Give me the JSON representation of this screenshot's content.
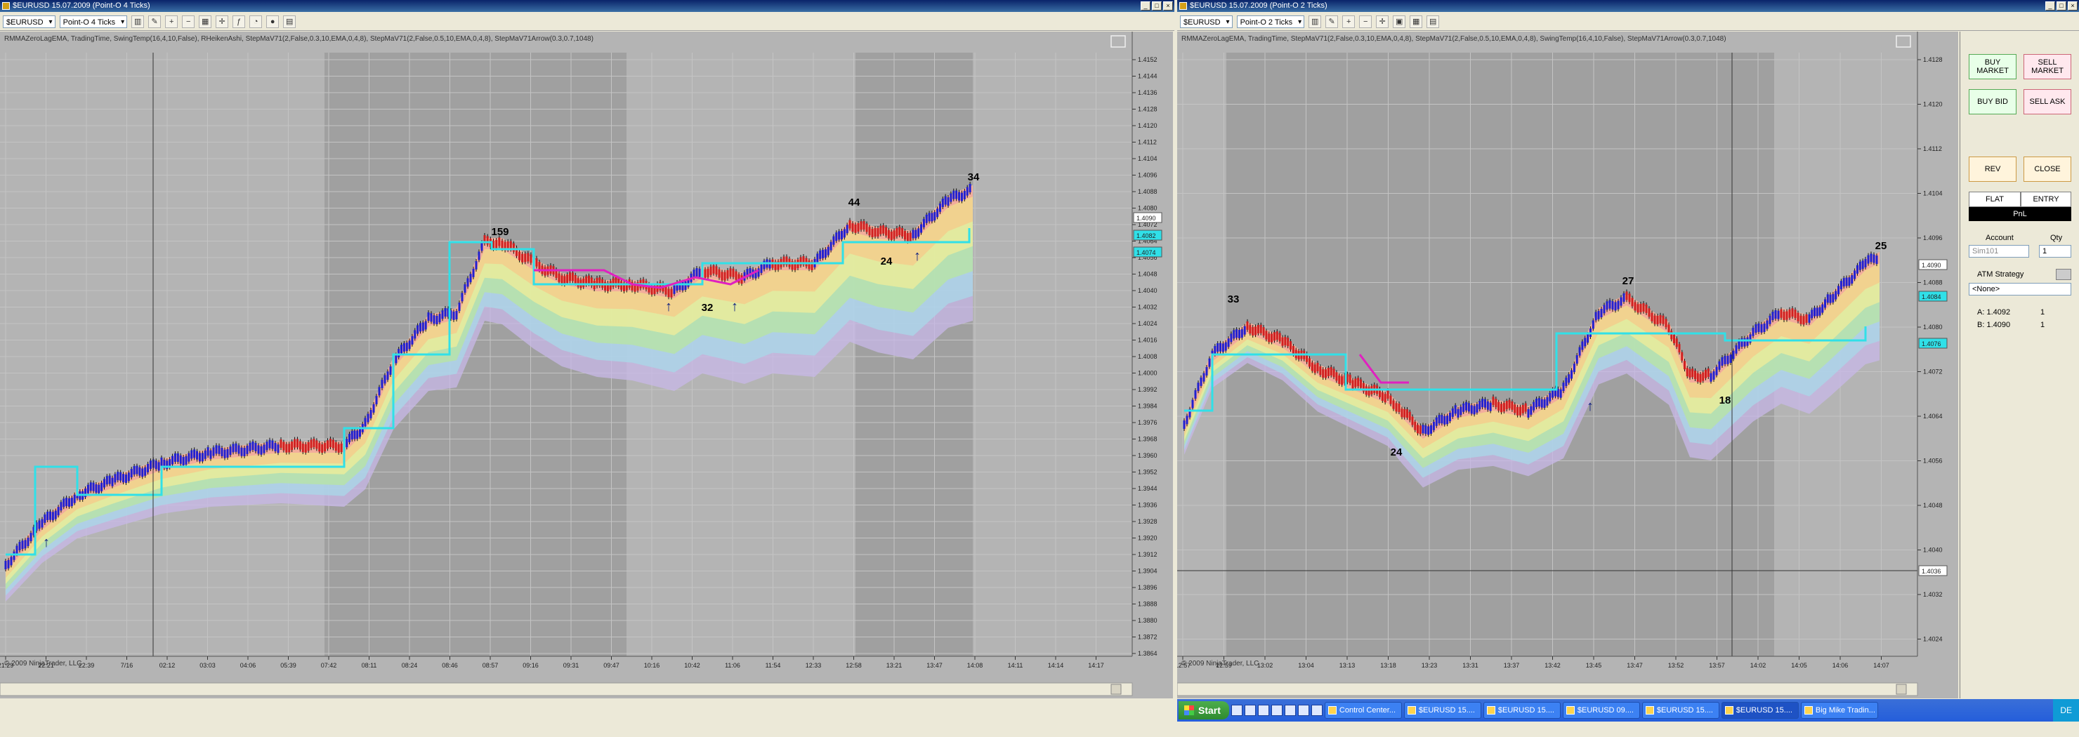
{
  "left_window": {
    "title": "$EURUSD 15.07.2009 (Point-O 4 Ticks)",
    "instrument": "$EURUSD",
    "period": "Point-O 4 Ticks",
    "indicators_label": "RMMAZeroLagEMA, TradingTime, SwingTemp(16,4,10,False), RHeikenAshi, StepMaV71(2,False,0.3,10,EMA,0,4,8), StepMaV71(2,False,0.5,10,EMA,0,4,8), StepMaV71Arrow(0.3,0.7,1048)",
    "copyright": "© 2009 NinjaTrader, LLC",
    "price_labels": [
      "1.4152",
      "1.4144",
      "1.4136",
      "1.4128",
      "1.4120",
      "1.4112",
      "1.4104",
      "1.4096",
      "1.4088",
      "1.4080",
      "1.4072",
      "1.4064",
      "1.4056",
      "1.4048",
      "1.4040",
      "1.4032",
      "1.4024",
      "1.4016",
      "1.4008",
      "1.4000",
      "1.3992",
      "1.3984",
      "1.3976",
      "1.3968",
      "1.3960",
      "1.3952",
      "1.3944",
      "1.3936",
      "1.3928",
      "1.3920",
      "1.3912",
      "1.3904",
      "1.3896",
      "1.3888",
      "1.3880",
      "1.3872",
      "1.3864"
    ],
    "price_tags": [
      "1.4090",
      "1.4082",
      "1.4074"
    ],
    "time_labels": [
      "21:29",
      "22:21",
      "22:39",
      "7/16",
      "02:12",
      "03:03",
      "04:06",
      "05:39",
      "07:42",
      "08:11",
      "08:24",
      "08:46",
      "08:57",
      "09:16",
      "09:31",
      "09:47",
      "10:16",
      "10:42",
      "11:06",
      "11:54",
      "12:33",
      "12:58",
      "13:21",
      "13:47",
      "14:08",
      "14:11",
      "14:14",
      "14:17"
    ],
    "swing_labels": [
      "159",
      "44",
      "34",
      "24",
      "32"
    ]
  },
  "right_window": {
    "title": "$EURUSD 15.07.2009 (Point-O 2 Ticks)",
    "instrument": "$EURUSD",
    "period": "Point-O 2 Ticks",
    "indicators_label": "RMMAZeroLagEMA, TradingTime, StepMaV71(2,False,0.3,10,EMA,0,4,8), StepMaV71(2,False,0.5,10,EMA,0,4,8), SwingTemp(16,4,10,False), StepMaV71Arrow(0.3,0.7,1048)",
    "copyright": "© 2009 NinjaTrader, LLC",
    "price_labels": [
      "1.4128",
      "1.4120",
      "1.4112",
      "1.4104",
      "1.4096",
      "1.4088",
      "1.4080",
      "1.4072",
      "1.4064",
      "1.4056",
      "1.4048",
      "1.4040",
      "1.4032",
      "1.4024"
    ],
    "price_tags": [
      "1.4090",
      "1.4084",
      "1.4076",
      "1.4036"
    ],
    "time_labels": [
      "12:57",
      "12:59",
      "13:02",
      "13:04",
      "13:13",
      "13:18",
      "13:23",
      "13:31",
      "13:37",
      "13:42",
      "13:45",
      "13:47",
      "13:52",
      "13:57",
      "14:02",
      "14:05",
      "14:06",
      "14:07"
    ],
    "swing_labels": [
      "33",
      "24",
      "27",
      "18",
      "25"
    ]
  },
  "order_panel": {
    "buy_market": "BUY MARKET",
    "sell_market": "SELL MARKET",
    "buy_bid": "BUY BID",
    "sell_ask": "SELL ASK",
    "rev": "REV",
    "close": "CLOSE",
    "flat": "FLAT",
    "entry": "ENTRY",
    "pnl": "PnL",
    "account_label": "Account",
    "qty_label": "Qty",
    "account_value": "Sim101",
    "qty_value": "1",
    "atm_label": "ATM Strategy",
    "atm_value": "<None>",
    "ask_line": "A: 1.4092",
    "bid_line": "B: 1.4090",
    "ask_qty": "1",
    "bid_qty": "1"
  },
  "taskbar": {
    "start": "Start",
    "tasks": [
      "Control Center...",
      "$EURUSD 15....",
      "$EURUSD 15....",
      "$EURUSD 09....",
      "$EURUSD 15....",
      "$EURUSD 15....",
      "Big Mike Tradin..."
    ],
    "tray": "DE"
  }
}
